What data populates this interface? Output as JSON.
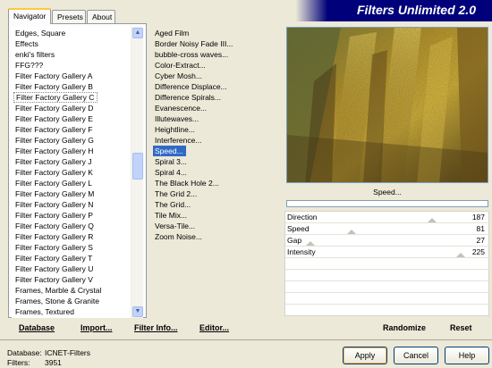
{
  "header": {
    "title": "Filters Unlimited 2.0"
  },
  "tabs": [
    {
      "label": "Navigator",
      "active": true
    },
    {
      "label": "Presets",
      "active": false
    },
    {
      "label": "About",
      "active": false
    }
  ],
  "categories": {
    "items": [
      "Edges, Square",
      "Effects",
      "enki's filters",
      "FFG???",
      "Filter Factory Gallery A",
      "Filter Factory Gallery B",
      "Filter Factory Gallery C",
      "Filter Factory Gallery D",
      "Filter Factory Gallery E",
      "Filter Factory Gallery F",
      "Filter Factory Gallery G",
      "Filter Factory Gallery H",
      "Filter Factory Gallery J",
      "Filter Factory Gallery K",
      "Filter Factory Gallery L",
      "Filter Factory Gallery M",
      "Filter Factory Gallery N",
      "Filter Factory Gallery P",
      "Filter Factory Gallery Q",
      "Filter Factory Gallery R",
      "Filter Factory Gallery S",
      "Filter Factory Gallery T",
      "Filter Factory Gallery U",
      "Filter Factory Gallery V",
      "Frames, Marble & Crystal",
      "Frames, Stone & Granite",
      "Frames, Textured"
    ],
    "focused_item": "Filter Factory Gallery C"
  },
  "filters": {
    "items": [
      "Aged Film",
      "Border Noisy Fade III...",
      "bubble-cross waves...",
      "Color-Extract...",
      "Cyber Mosh...",
      "Difference Displace...",
      "Difference Spirals...",
      "Evanescence...",
      "Illutewaves...",
      "Heightline...",
      "Interference...",
      "Speed...",
      "Spiral 3...",
      "Spiral 4...",
      "The Black Hole 2...",
      "The Grid 2...",
      "The Grid...",
      "Tile Mix...",
      "Versa-Tile...",
      "Zoom Noise..."
    ],
    "selected_item": "Speed..."
  },
  "toolbar": {
    "database": "Database",
    "import": "Import...",
    "filter_info": "Filter Info...",
    "editor": "Editor..."
  },
  "preview": {
    "caption": "Speed..."
  },
  "controls": [
    {
      "label": "Direction",
      "value": "187",
      "fraction": 0.733
    },
    {
      "label": "Speed",
      "value": "81",
      "fraction": 0.318
    },
    {
      "label": "Gap",
      "value": "27",
      "fraction": 0.106
    },
    {
      "label": "Intensity",
      "value": "225",
      "fraction": 0.882
    }
  ],
  "actions": {
    "randomize": "Randomize",
    "reset": "Reset"
  },
  "status": {
    "database_label": "Database:",
    "database_value": "ICNET-Filters",
    "filters_label": "Filters:",
    "filters_value": "3951"
  },
  "buttons": {
    "apply": "Apply",
    "cancel": "Cancel",
    "help": "Help"
  },
  "colors": {
    "header_bg": "#00007b",
    "selection": "#316ac5",
    "window_bg": "#ece9d8"
  }
}
